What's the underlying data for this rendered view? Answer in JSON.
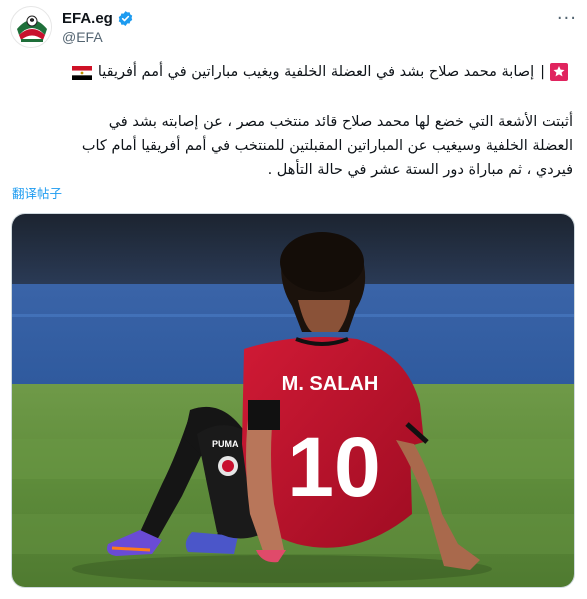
{
  "tweet": {
    "author": {
      "display_name": "EFA.eg",
      "handle": "@EFA",
      "verified": true,
      "avatar_icon": "efa-logo-icon"
    },
    "more_label": "···",
    "headline": {
      "leading_icon": "red-square-badge-icon",
      "separator": "|",
      "text": "إصابة محمد صلاح بشد في العضلة الخلفية ويغيب مباراتين في أمم أفريقيا",
      "trailing_icon": "egypt-flag-icon"
    },
    "body_lines": [
      "أثبتت الأشعة التي خضع لها محمد صلاح قائد منتخب مصر ، عن إصابته بشد في",
      "العضلة الخلفية وسيغيب عن المباراتين المقبلتين للمنتخب في أمم أفريقيا أمام كاب",
      "فيردي ، ثم مباراة دور الستة عشر  في حالة التأهل ."
    ],
    "translate_label": "翻译帖子",
    "media": {
      "jersey_name": "M. SALAH",
      "jersey_number": "10",
      "kit_brand": "PUMA"
    }
  },
  "colors": {
    "link": "#1d9bf0",
    "verified_badge": "#1d9bf0",
    "jersey_red": "#c8102e",
    "pitch_green": "#5d8b3a",
    "stadium_blue": "#2f5a9e"
  }
}
